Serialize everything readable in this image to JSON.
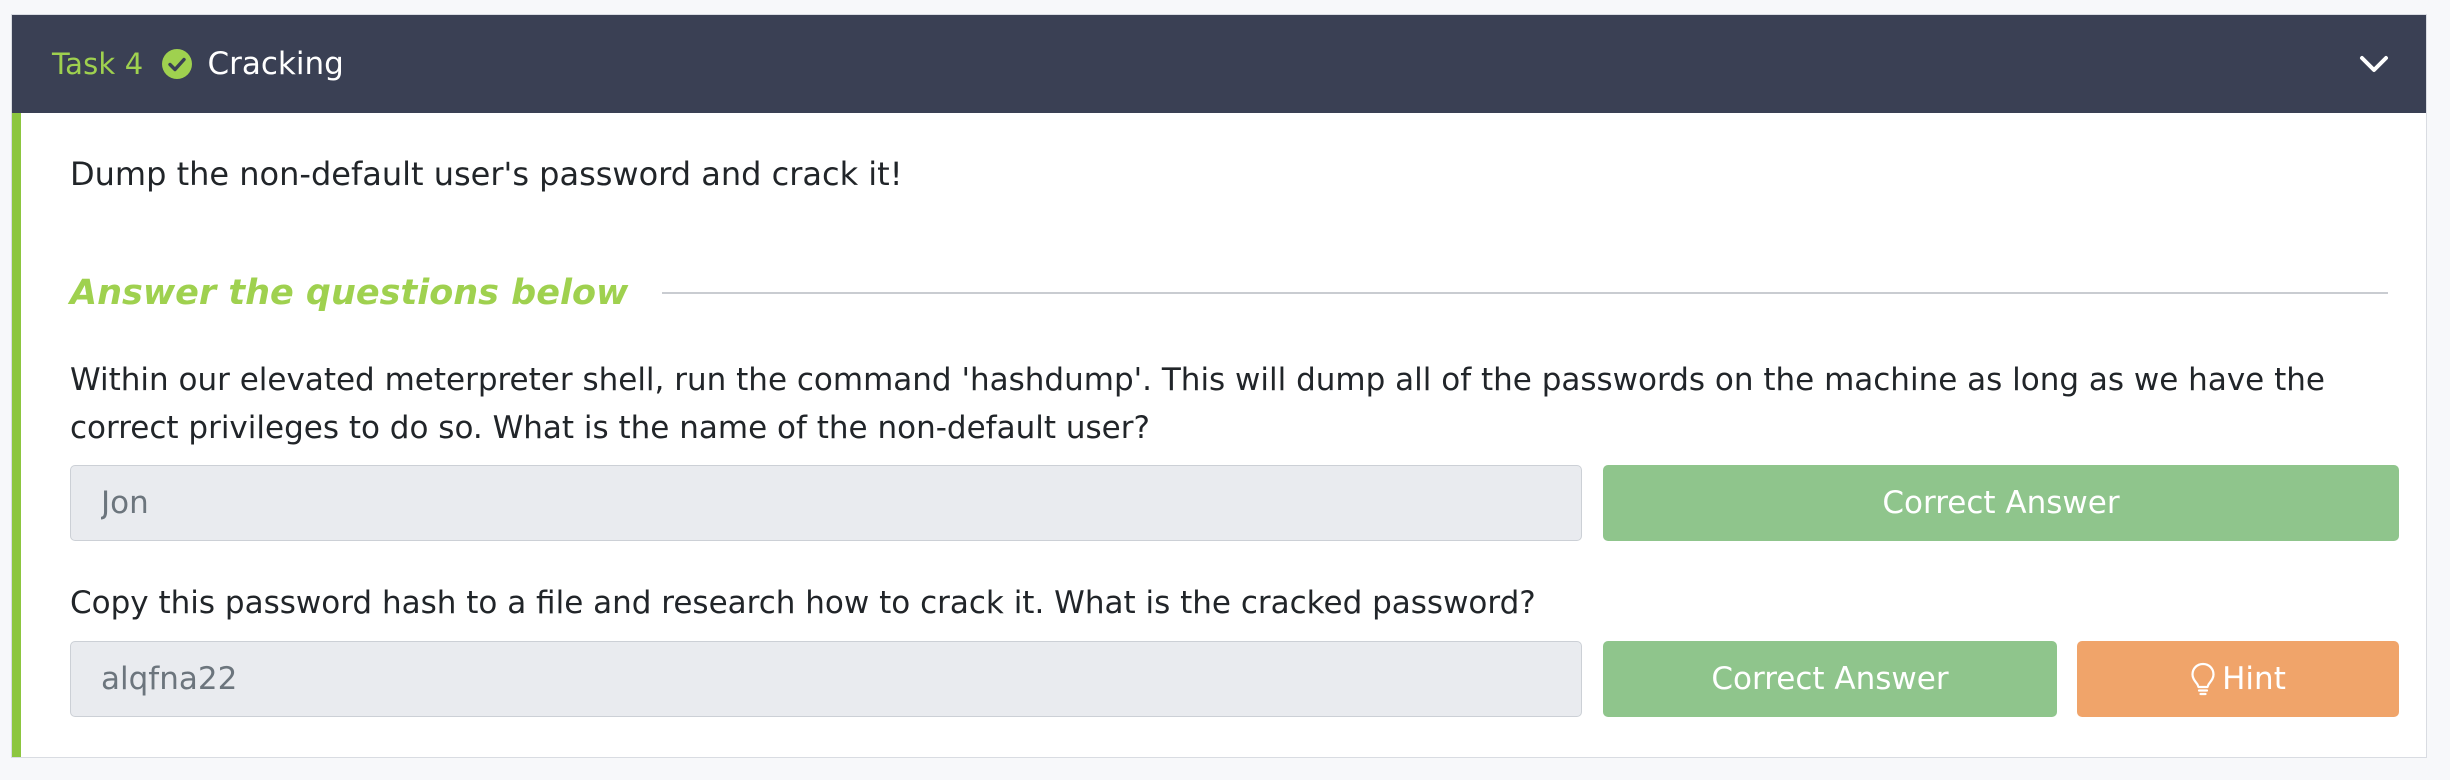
{
  "task": {
    "label": "Task 4",
    "title": "Cracking",
    "status_icon": "check-circle-icon",
    "toggle_icon": "chevron-down-icon"
  },
  "description": "Dump the non-default user's password and crack it!",
  "section_title": "Answer the questions below",
  "questions": [
    {
      "text": "Within our elevated meterpreter shell, run the command 'hashdump'. This will dump all of the passwords on the machine as long as we have the correct privileges to do so. What is the name of the non-default user?",
      "answer": "Jon",
      "button_label": "Correct Answer"
    },
    {
      "text": "Copy this password hash to a file and research how to crack it. What is the cracked password?",
      "answer": "alqfna22",
      "button_label": "Correct Answer",
      "hint_label": "Hint",
      "hint_icon": "lightbulb-icon"
    }
  ],
  "colors": {
    "header_bg": "#3a4054",
    "accent_green": "#9fd14f",
    "correct_button": "#8fc58c",
    "hint_button": "#f0a46a"
  }
}
